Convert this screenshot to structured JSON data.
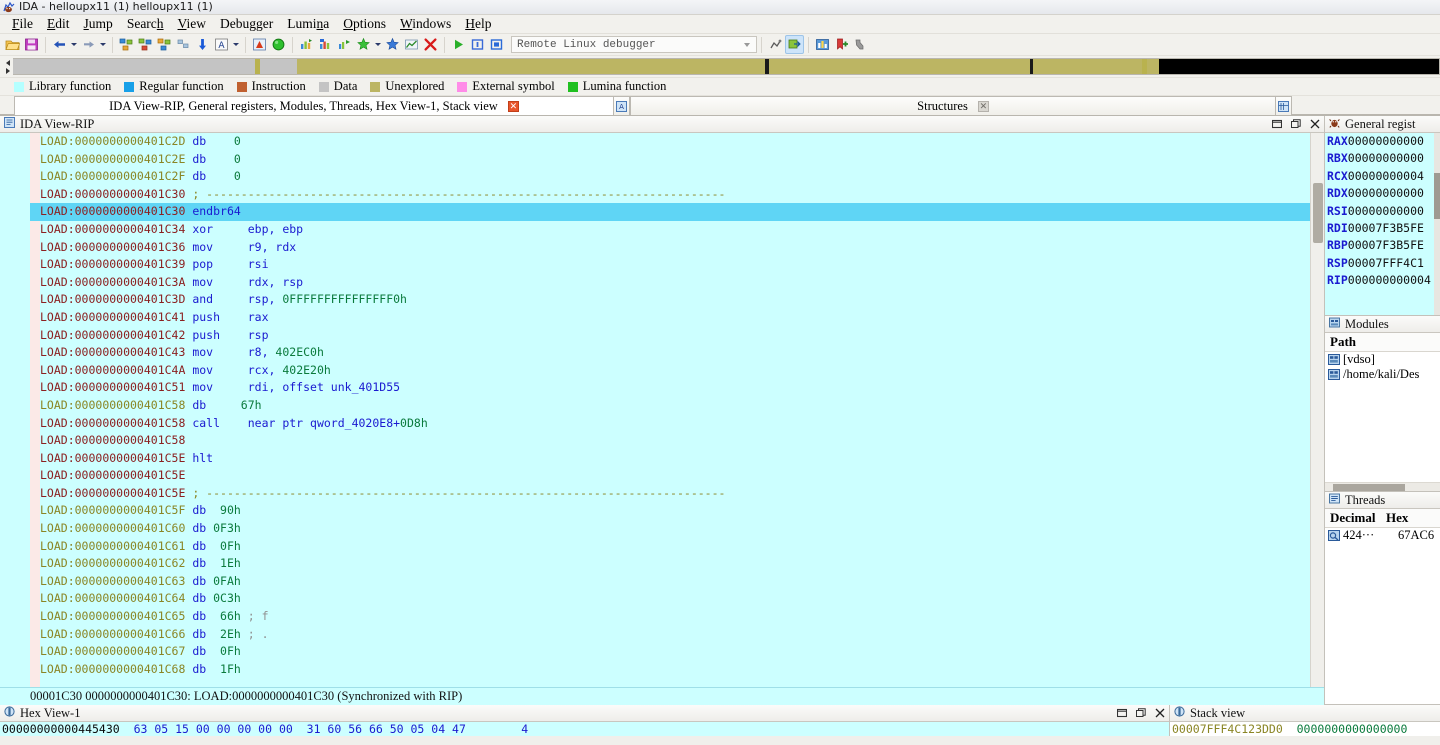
{
  "window": {
    "title": "IDA - helloupx11 (1) helloupx11 (1)",
    "icon": "ida-app-icon"
  },
  "menu": [
    {
      "label": "File",
      "accel": "F"
    },
    {
      "label": "Edit",
      "accel": "E"
    },
    {
      "label": "Jump",
      "accel": "J"
    },
    {
      "label": "Search",
      "accel": "h"
    },
    {
      "label": "View",
      "accel": "V"
    },
    {
      "label": "Debugger",
      "accel": "g"
    },
    {
      "label": "Lumina",
      "accel": "n"
    },
    {
      "label": "Options",
      "accel": "O"
    },
    {
      "label": "Windows",
      "accel": "W"
    },
    {
      "label": "Help",
      "accel": "H"
    }
  ],
  "toolbar": {
    "buttons": [
      {
        "name": "open-file-icon",
        "glyph": "folder"
      },
      {
        "name": "save-file-icon",
        "glyph": "save"
      },
      {
        "name": "nav-back-icon",
        "glyph": "arrow-left"
      },
      {
        "name": "nav-back-dropdown-icon",
        "glyph": "caret"
      },
      {
        "name": "nav-forward-icon",
        "glyph": "arrow-right"
      },
      {
        "name": "nav-forward-dropdown-icon",
        "glyph": "caret"
      },
      {
        "name": "graph-view-icon",
        "glyph": "graph1"
      },
      {
        "name": "proximity-view-icon",
        "glyph": "graph2"
      },
      {
        "name": "flow-chart-icon",
        "glyph": "graph3"
      },
      {
        "name": "xrefs-icon",
        "glyph": "graph4"
      },
      {
        "name": "jump-down-icon",
        "glyph": "down-arrow"
      },
      {
        "name": "text-view-icon",
        "glyph": "letter-a"
      },
      {
        "name": "text-view-dropdown-icon",
        "glyph": "caret"
      },
      {
        "name": "warning-marker-icon",
        "glyph": "tri-a"
      },
      {
        "name": "green-circle-icon",
        "glyph": "circle-green"
      },
      {
        "name": "run-to-icon",
        "glyph": "chart1"
      },
      {
        "name": "trace-icon",
        "glyph": "chart2"
      },
      {
        "name": "step-into-icon",
        "glyph": "chart3"
      },
      {
        "name": "step-over-icon",
        "glyph": "star-green"
      },
      {
        "name": "step-dropdown-icon",
        "glyph": "caret"
      },
      {
        "name": "run-icon",
        "glyph": "star-blue"
      },
      {
        "name": "stats-icon",
        "glyph": "chart4"
      },
      {
        "name": "stop-process-icon",
        "glyph": "red-x"
      },
      {
        "name": "start-debug-icon",
        "glyph": "play"
      },
      {
        "name": "pause-debug-icon",
        "glyph": "pause"
      },
      {
        "name": "terminate-debug-icon",
        "glyph": "stop"
      }
    ],
    "debugger_select": "Remote Linux debugger",
    "right_buttons": [
      {
        "name": "breakpoints-icon",
        "glyph": "bp1"
      },
      {
        "name": "attach-process-icon",
        "glyph": "bp2"
      },
      {
        "name": "chart-blue-icon",
        "glyph": "chart-blue"
      },
      {
        "name": "add-bookmark-icon",
        "glyph": "bookmark"
      },
      {
        "name": "watch-icon",
        "glyph": "watch"
      }
    ]
  },
  "navigator": {
    "segments": [
      {
        "color": "#c4c4c4",
        "width": 17.0
      },
      {
        "color": "#b9b24e",
        "width": 0.35
      },
      {
        "color": "#c4c4c4",
        "width": 2.6
      },
      {
        "color": "#bcb563",
        "width": 32.8
      },
      {
        "color": "#1a1a1a",
        "width": 0.25
      },
      {
        "color": "#bcb563",
        "width": 18.3
      },
      {
        "color": "#1a1a1a",
        "width": 0.25
      },
      {
        "color": "#bcb563",
        "width": 7.6
      },
      {
        "color": "#b9b24e",
        "width": 0.35
      },
      {
        "color": "#bcb563",
        "width": 0.9
      },
      {
        "color": "#000000",
        "width": 19.6
      }
    ]
  },
  "legend": [
    {
      "label": "Library function",
      "color": "#b4ffff"
    },
    {
      "label": "Regular function",
      "color": "#18a0e8"
    },
    {
      "label": "Instruction",
      "color": "#c06030"
    },
    {
      "label": "Data",
      "color": "#c4c4c4"
    },
    {
      "label": "Unexplored",
      "color": "#bcb563"
    },
    {
      "label": "External symbol",
      "color": "#ff8ce8"
    },
    {
      "label": "Lumina function",
      "color": "#20c020"
    }
  ],
  "tabstrip": {
    "tabs": [
      {
        "label": "IDA View-RIP, General registers, Modules, Threads, Hex View-1, Stack view",
        "active": true,
        "close": "red"
      },
      {
        "label": "Structures",
        "active": false,
        "close": "grey"
      }
    ],
    "tab_icons": [
      "ida-view-icon",
      "structures-icon"
    ]
  },
  "disassembly": {
    "panel_title": "IDA View-RIP",
    "panel_icon": "ida-view-icon",
    "controls": [
      "restore-icon",
      "maximize-icon",
      "close-icon"
    ],
    "status": "00001C30 0000000000401C30: LOAD:0000000000401C30 (Synchronized with RIP)",
    "rip_marker": "RIP",
    "segment": "LOAD",
    "lines": [
      {
        "dot": true,
        "addr": "0000000000401C2D",
        "unexplored": true,
        "mnem": "db",
        "gap": "    ",
        "op": "",
        "num": "0",
        "cmt": ""
      },
      {
        "dot": true,
        "addr": "0000000000401C2E",
        "unexplored": true,
        "mnem": "db",
        "gap": "    ",
        "op": "",
        "num": "0",
        "cmt": ""
      },
      {
        "dot": true,
        "addr": "0000000000401C2F",
        "unexplored": true,
        "mnem": "db",
        "gap": "    ",
        "op": "",
        "num": "0",
        "cmt": ""
      },
      {
        "dot": false,
        "addr": "0000000000401C30",
        "unexplored": false,
        "rule": "; ---------------------------------------------------------------------------"
      },
      {
        "dot": false,
        "addr": "0000000000401C30",
        "unexplored": false,
        "mnem": "endbr64",
        "gap": "",
        "op": "",
        "num": "",
        "cmt": "",
        "highlight": true,
        "rip": true
      },
      {
        "dot": true,
        "addr": "0000000000401C34",
        "unexplored": false,
        "mnem": "xor",
        "gap": "     ",
        "op": "ebp, ebp",
        "num": "",
        "cmt": ""
      },
      {
        "dot": true,
        "addr": "0000000000401C36",
        "unexplored": false,
        "mnem": "mov",
        "gap": "     ",
        "op": "r9, rdx",
        "num": "",
        "cmt": ""
      },
      {
        "dot": true,
        "addr": "0000000000401C39",
        "unexplored": false,
        "mnem": "pop",
        "gap": "     ",
        "op": "rsi",
        "num": "",
        "cmt": ""
      },
      {
        "dot": true,
        "addr": "0000000000401C3A",
        "unexplored": false,
        "mnem": "mov",
        "gap": "     ",
        "op": "rdx, rsp",
        "num": "",
        "cmt": ""
      },
      {
        "dot": true,
        "addr": "0000000000401C3D",
        "unexplored": false,
        "mnem": "and",
        "gap": "     ",
        "op": "rsp, ",
        "num": "0FFFFFFFFFFFFFFF0h",
        "cmt": ""
      },
      {
        "dot": true,
        "addr": "0000000000401C41",
        "unexplored": false,
        "mnem": "push",
        "gap": "    ",
        "op": "rax",
        "num": "",
        "cmt": ""
      },
      {
        "dot": true,
        "addr": "0000000000401C42",
        "unexplored": false,
        "mnem": "push",
        "gap": "    ",
        "op": "rsp",
        "num": "",
        "cmt": ""
      },
      {
        "dot": true,
        "addr": "0000000000401C43",
        "unexplored": false,
        "mnem": "mov",
        "gap": "     ",
        "op": "r8, ",
        "num": "402EC0h",
        "cmt": ""
      },
      {
        "dot": true,
        "addr": "0000000000401C4A",
        "unexplored": false,
        "mnem": "mov",
        "gap": "     ",
        "op": "rcx, ",
        "num": "402E20h",
        "cmt": ""
      },
      {
        "dot": true,
        "addr": "0000000000401C51",
        "unexplored": false,
        "mnem": "mov",
        "gap": "     ",
        "op": "rdi, offset unk_401D55",
        "num": "",
        "cmt": ""
      },
      {
        "dot": false,
        "addr": "0000000000401C58",
        "unexplored": true,
        "mnem": "db",
        "gap": "     ",
        "op": "",
        "num": "67h",
        "cmt": ""
      },
      {
        "dot": true,
        "addr": "0000000000401C58",
        "unexplored": false,
        "mnem": "call",
        "gap": "    ",
        "op": "near ptr qword_4020E8+",
        "num": "0D8h",
        "cmt": ""
      },
      {
        "dot": false,
        "addr": "0000000000401C58",
        "unexplored": false,
        "mnem": "",
        "gap": "",
        "op": "",
        "num": "",
        "cmt": ""
      },
      {
        "dot": true,
        "addr": "0000000000401C5E",
        "unexplored": false,
        "mnem": "hlt",
        "gap": "",
        "op": "",
        "num": "",
        "cmt": ""
      },
      {
        "dot": false,
        "addr": "0000000000401C5E",
        "unexplored": false,
        "mnem": "",
        "gap": "",
        "op": "",
        "num": "",
        "cmt": ""
      },
      {
        "dot": false,
        "addr": "0000000000401C5E",
        "unexplored": false,
        "rule": "; ---------------------------------------------------------------------------"
      },
      {
        "dot": true,
        "addr": "0000000000401C5F",
        "unexplored": true,
        "mnem": "db",
        "gap": "  ",
        "op": "",
        "num": "90h",
        "cmt": ""
      },
      {
        "dot": true,
        "addr": "0000000000401C60",
        "unexplored": true,
        "mnem": "db",
        "gap": " ",
        "op": "",
        "num": "0F3h",
        "cmt": ""
      },
      {
        "dot": true,
        "addr": "0000000000401C61",
        "unexplored": true,
        "mnem": "db",
        "gap": "  ",
        "op": "",
        "num": "0Fh",
        "cmt": ""
      },
      {
        "dot": true,
        "addr": "0000000000401C62",
        "unexplored": true,
        "mnem": "db",
        "gap": "  ",
        "op": "",
        "num": "1Eh",
        "cmt": ""
      },
      {
        "dot": true,
        "addr": "0000000000401C63",
        "unexplored": true,
        "mnem": "db",
        "gap": " ",
        "op": "",
        "num": "0FAh",
        "cmt": ""
      },
      {
        "dot": true,
        "addr": "0000000000401C64",
        "unexplored": true,
        "mnem": "db",
        "gap": " ",
        "op": "",
        "num": "0C3h",
        "cmt": ""
      },
      {
        "dot": true,
        "addr": "0000000000401C65",
        "unexplored": true,
        "mnem": "db",
        "gap": "  ",
        "op": "",
        "num": "66h",
        "cmt": " ; f"
      },
      {
        "dot": true,
        "addr": "0000000000401C66",
        "unexplored": true,
        "mnem": "db",
        "gap": "  ",
        "op": "",
        "num": "2Eh",
        "cmt": " ; ."
      },
      {
        "dot": true,
        "addr": "0000000000401C67",
        "unexplored": true,
        "mnem": "db",
        "gap": "  ",
        "op": "",
        "num": "0Fh",
        "cmt": ""
      },
      {
        "dot": true,
        "addr": "0000000000401C68",
        "unexplored": true,
        "mnem": "db",
        "gap": "  ",
        "op": "",
        "num": "1Fh",
        "cmt": ""
      }
    ]
  },
  "registers": {
    "panel_title": "General regist",
    "panel_icon": "debugger-bug-icon",
    "rows": [
      {
        "name": "RAX",
        "value": "00000000000"
      },
      {
        "name": "RBX",
        "value": "00000000000"
      },
      {
        "name": "RCX",
        "value": "00000000004"
      },
      {
        "name": "RDX",
        "value": "00000000000"
      },
      {
        "name": "RSI",
        "value": "00000000000"
      },
      {
        "name": "RDI",
        "value": "00007F3B5FE"
      },
      {
        "name": "RBP",
        "value": "00007F3B5FE"
      },
      {
        "name": "RSP",
        "value": "00007FFF4C1"
      },
      {
        "name": "RIP",
        "value": "000000000004"
      }
    ]
  },
  "modules": {
    "panel_title": "Modules",
    "panel_icon": "modules-icon",
    "column": "Path",
    "rows": [
      {
        "icon": "module-icon",
        "path": "/home/kali/Des"
      },
      {
        "icon": "module-icon",
        "path": "[vdso]"
      }
    ]
  },
  "threads": {
    "panel_title": "Threads",
    "panel_icon": "threads-icon",
    "columns": [
      "Decimal",
      "Hex"
    ],
    "rows": [
      {
        "icon": "thread-icon",
        "decimal": "424···",
        "hex": "67AC6"
      }
    ]
  },
  "hexview": {
    "panel_title": "Hex View-1",
    "panel_icon": "hex-view-icon",
    "controls": [
      "restore-icon",
      "maximize-icon",
      "close-icon"
    ],
    "rows": [
      {
        "addr": "00000000000445430",
        "bytes": "63 05 15 00 00 00 00 00  31 60 56 66 50 05 04 47",
        "ascii": "4"
      }
    ]
  },
  "stackview": {
    "panel_title": "Stack view",
    "panel_icon": "stack-view-icon",
    "rows": [
      {
        "addr": "00007FFF4C123DD0",
        "value": "0000000000000000"
      }
    ]
  },
  "colors": {
    "code_bg": "#ccffff",
    "highlight": "#5fd5f5",
    "rip_marker_bg": "#2222dd",
    "segment_name": "#8b2020",
    "unexplored_addr": "#8a8524",
    "mnemonic": "#1a1ad0",
    "number": "#0a7a3c",
    "comment": "#909090",
    "chrome": "#f2f1ed"
  }
}
